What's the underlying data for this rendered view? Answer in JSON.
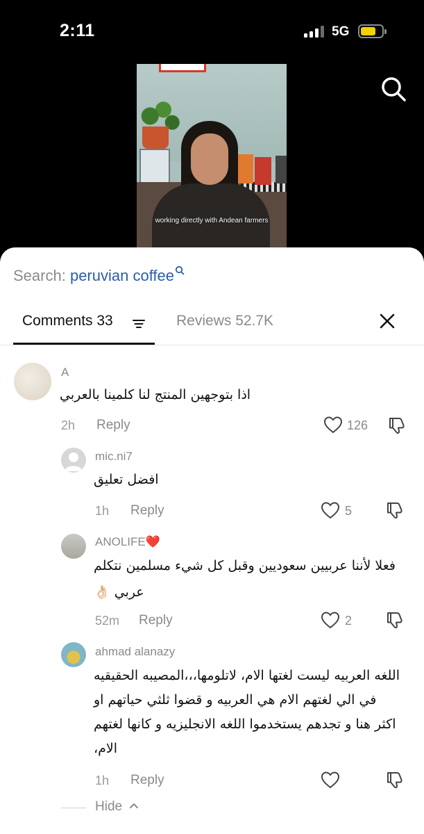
{
  "status_bar": {
    "time": "2:11",
    "network": "5G",
    "signal_bars_filled": 3,
    "signal_bars_total": 4,
    "battery_color": "#f5d000"
  },
  "video": {
    "caption": "working directly with Andean farmers"
  },
  "search": {
    "label": "Search:",
    "term": "peruvian coffee"
  },
  "tabs": {
    "comments": "Comments 33",
    "reviews": "Reviews 52.7K"
  },
  "comments": [
    {
      "username": "A",
      "text": "اذا بتوجهين المنتج لنا كلمينا بالعربي",
      "time": "2h",
      "reply": "Reply",
      "likes": "126"
    },
    {
      "username": "mic.ni7",
      "text": "افضل تعليق",
      "time": "1h",
      "reply": "Reply",
      "likes": "5"
    },
    {
      "username": "ANOLIFE❤️",
      "text_line1": "فعلا لأننا عربيين سعوديين وقبل كل شيء مسلمين نتكلم",
      "text_line2": "عربي 👌🏻",
      "time": "52m",
      "reply": "Reply",
      "likes": "2"
    },
    {
      "username": "ahmad alanazy",
      "text_line1": "اللغه العربيه ليست لغتها الام، لاتلومها،،،المصيبه الحقيقيه",
      "text_line2": "في الي لغتهم الام هي العربيه و قضوا ثلثي حياتهم او",
      "text_line3": "اكثر هنا و تجدهم يستخدموا اللغه الانجليزيه و كانها لغتهم",
      "text_line4": "الام،",
      "time": "1h",
      "reply": "Reply",
      "likes": ""
    }
  ],
  "hide_label": "Hide"
}
